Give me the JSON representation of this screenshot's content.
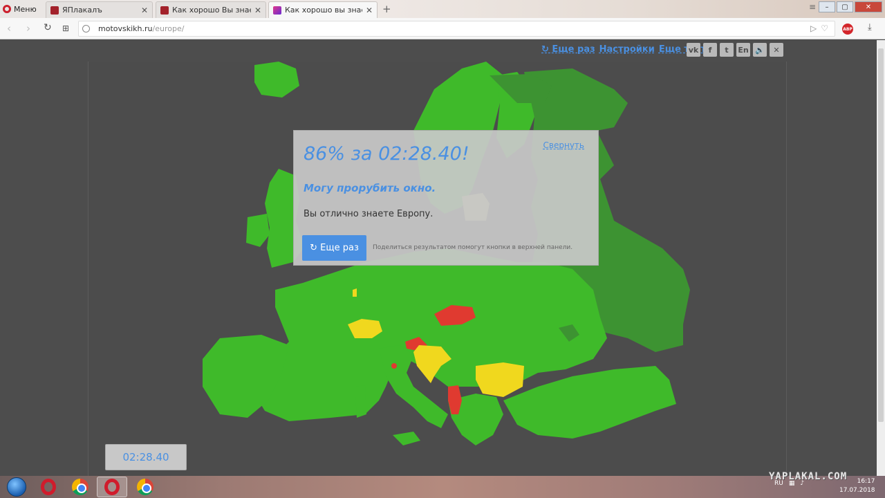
{
  "browser": {
    "menu_label": "Меню",
    "tabs": [
      {
        "title": "ЯПлакалъ"
      },
      {
        "title": "Как хорошо Вы знаете ка"
      },
      {
        "title": "Как хорошо вы знаете Ев"
      }
    ],
    "url_host": "motovskikh.ru",
    "url_path": "/europe/"
  },
  "toolbar": {
    "again_link": "↻ Еще раз",
    "settings_link": "Настройки",
    "more_tests_link": "Еще тесты",
    "social_buttons": [
      "vk",
      "f",
      "t",
      "En",
      "🔊",
      "✕"
    ]
  },
  "result": {
    "score_text": "86% за 02:28.40!",
    "collapse_link": "Свернуть",
    "quote": "Могу прорубить окно.",
    "verdict": "Вы отлично знаете Европу.",
    "again_button": "↻ Еще раз",
    "share_hint": "Поделиться результатом помогут кнопки в верхней панели."
  },
  "timer": {
    "value": "02:28.40"
  },
  "map": {
    "colors": {
      "correct": "#3fba2a",
      "unanswered": "#3d9332",
      "second_try": "#f0d81e",
      "wrong": "#e03a30",
      "sea": "#4c4c4c",
      "highlight": "#c9c27a"
    }
  },
  "taskbar": {
    "tray_lang": "RU",
    "time": "16:17",
    "date": "17.07.2018"
  },
  "watermark": "YAPLAKAL.COM"
}
